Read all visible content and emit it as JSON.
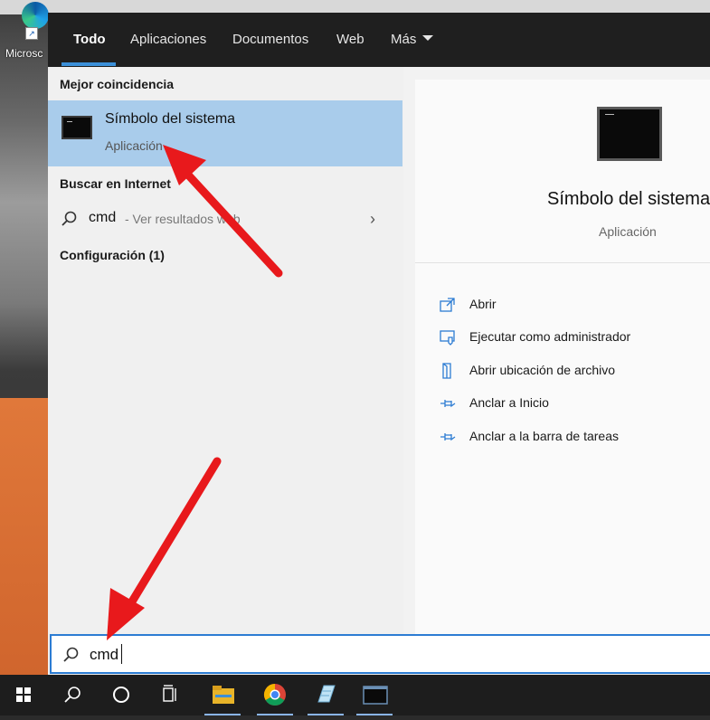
{
  "desktop": {
    "icon_label": "Microsc"
  },
  "tabs": [
    {
      "label": "Todo",
      "active": true
    },
    {
      "label": "Aplicaciones",
      "active": false
    },
    {
      "label": "Documentos",
      "active": false
    },
    {
      "label": "Web",
      "active": false
    },
    {
      "label": "Más",
      "active": false
    }
  ],
  "left": {
    "best_match_title": "Mejor coincidencia",
    "best_match": {
      "name": "Símbolo del sistema",
      "type": "Aplicación",
      "icon": "command-prompt-icon"
    },
    "web_title": "Buscar en Internet",
    "web_query": "cmd",
    "web_hint": "- Ver resultados web",
    "settings_title": "Configuración (1)"
  },
  "detail": {
    "title": "Símbolo del sistema",
    "type": "Aplicación",
    "actions": [
      {
        "label": "Abrir",
        "icon": "open-icon"
      },
      {
        "label": "Ejecutar como administrador",
        "icon": "run-as-admin-icon"
      },
      {
        "label": "Abrir ubicación de archivo",
        "icon": "file-location-icon"
      },
      {
        "label": "Anclar a Inicio",
        "icon": "pin-icon"
      },
      {
        "label": "Anclar a la barra de tareas",
        "icon": "pin-taskbar-icon"
      }
    ]
  },
  "search": {
    "value": "cmd"
  },
  "taskbar": {
    "items": [
      "windows-start-icon",
      "search-icon",
      "cortana-icon",
      "task-view-icon",
      "file-explorer-icon",
      "chrome-icon",
      "notepad-icon",
      "command-prompt-icon"
    ]
  },
  "colors": {
    "accent": "#2c7cd3",
    "selected": "#a9cceb",
    "arrow": "#e8191c",
    "tabbar": "#1f1f1f"
  }
}
